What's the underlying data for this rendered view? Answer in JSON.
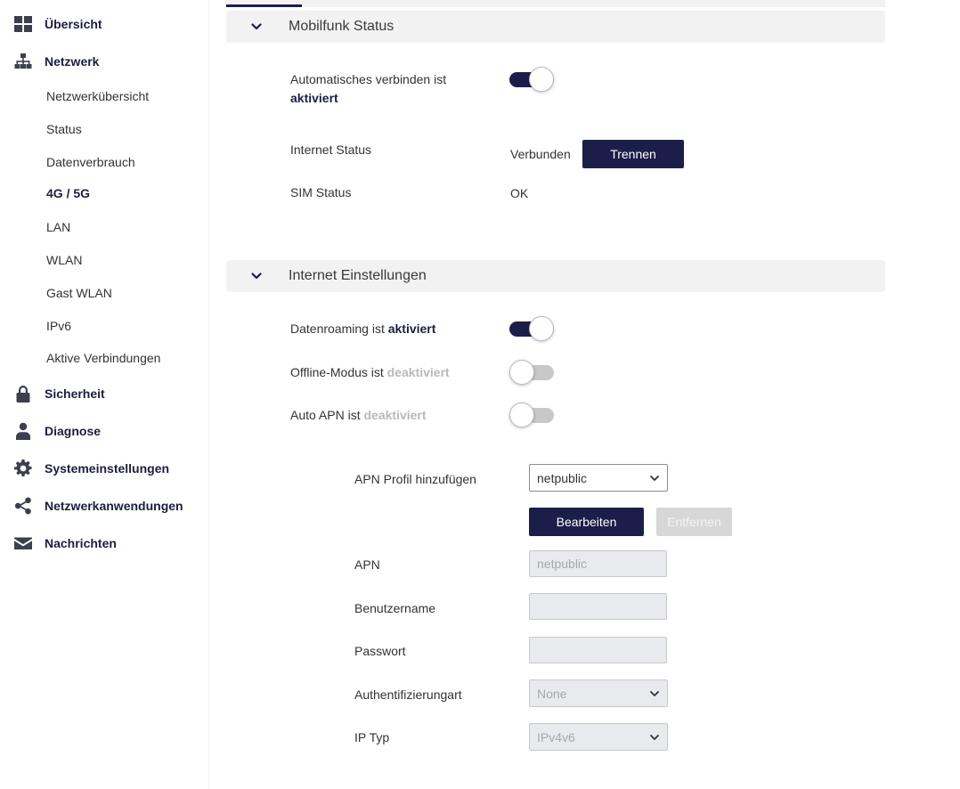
{
  "sidebar": {
    "main_items": [
      {
        "label": "Übersicht",
        "icon": "dashboard-grid-icon"
      },
      {
        "label": "Netzwerk",
        "icon": "network-tree-icon"
      },
      {
        "label": "Sicherheit",
        "icon": "lock-icon"
      },
      {
        "label": "Diagnose",
        "icon": "technician-icon"
      },
      {
        "label": "Systemeinstellungen",
        "icon": "gear-icon"
      },
      {
        "label": "Netzwerkanwendungen",
        "icon": "share-icon"
      },
      {
        "label": "Nachrichten",
        "icon": "envelope-icon"
      }
    ],
    "network_sub_items": [
      "Netzwerkübersicht",
      "Status",
      "Datenverbrauch",
      "4G / 5G",
      "LAN",
      "WLAN",
      "Gast WLAN",
      "IPv6",
      "Aktive Verbindungen"
    ],
    "active_sub_item": "4G / 5G"
  },
  "mobile_status": {
    "title": "Mobilfunk Status",
    "auto_connect": {
      "label_prefix": "Automatisches verbinden ist",
      "state_label": "aktiviert",
      "enabled": true
    },
    "internet_status": {
      "label": "Internet Status",
      "value": "Verbunden",
      "button": "Trennen"
    },
    "sim_status": {
      "label": "SIM Status",
      "value": "OK"
    }
  },
  "internet_settings": {
    "title": "Internet Einstellungen",
    "data_roaming": {
      "label_prefix": "Datenroaming ist",
      "state_label": "aktiviert",
      "enabled": true
    },
    "offline_mode": {
      "label_prefix": "Offline-Modus ist",
      "state_label": "deaktiviert",
      "enabled": false
    },
    "auto_apn": {
      "label_prefix": "Auto APN ist",
      "state_label": "deaktiviert",
      "enabled": false
    },
    "apn_profile": {
      "label": "APN Profil hinzufügen",
      "selected": "netpublic"
    },
    "edit_button": "Bearbeiten",
    "remove_button": "Entfernen",
    "apn": {
      "label": "APN",
      "value": "netpublic"
    },
    "username": {
      "label": "Benutzername",
      "value": ""
    },
    "password": {
      "label": "Passwort",
      "value": ""
    },
    "auth_type": {
      "label": "Authentifizierungart",
      "selected": "None"
    },
    "ip_type": {
      "label": "IP Typ",
      "selected": "IPv4v6"
    }
  },
  "colors": {
    "accent": "#1c1e4a",
    "toggle_off": "#c8c8c8",
    "section_header_bg": "#f2f2f2",
    "disabled_text": "#b9b9b9"
  }
}
